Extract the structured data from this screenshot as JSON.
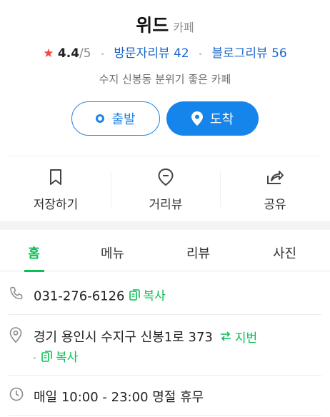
{
  "place": {
    "name": "위드",
    "category": "카페",
    "rating": "4.4",
    "rating_max": "/5",
    "visitor_reviews": "방문자리뷰 42",
    "blog_reviews": "블로그리뷰 56",
    "description": "수지 신봉동 분위기 좋은 카페"
  },
  "buttons": {
    "depart": "출발",
    "arrive": "도착"
  },
  "actions": [
    {
      "label": "저장하기",
      "icon": "bookmark-icon"
    },
    {
      "label": "거리뷰",
      "icon": "street-view-pin-icon"
    },
    {
      "label": "공유",
      "icon": "share-icon"
    }
  ],
  "tabs": [
    {
      "label": "홈",
      "active": true
    },
    {
      "label": "메뉴",
      "active": false
    },
    {
      "label": "리뷰",
      "active": false
    },
    {
      "label": "사진",
      "active": false
    }
  ],
  "info": {
    "phone": "031-276-6126",
    "phone_copy": "복사",
    "address": "경기 용인시 수지구 신봉1로 373",
    "address_toggle": "지번",
    "address_copy": "복사",
    "hours": "매일 10:00 - 23:00 명절 휴무"
  },
  "colors": {
    "accent_blue": "#1584eb",
    "link_blue": "#1a66c9",
    "accent_green": "#0abf53",
    "star_red": "#f2453d"
  }
}
